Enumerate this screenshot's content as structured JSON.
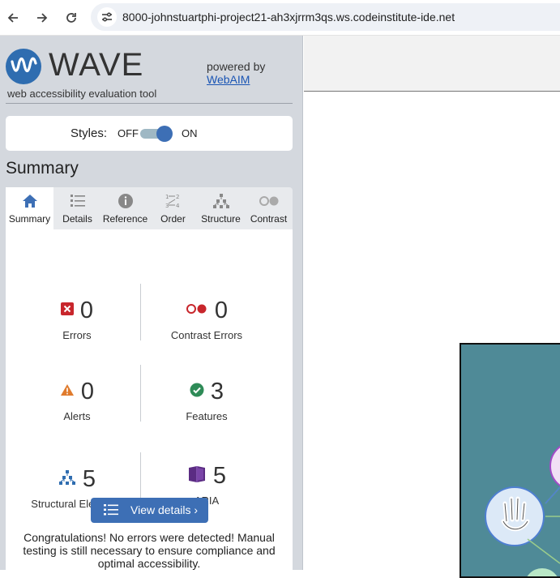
{
  "browser": {
    "url": "8000-johnstuartphi-project21-ah3xjrrm3qs.ws.codeinstitute-ide.net",
    "icons": [
      "back-arrow-icon",
      "forward-arrow-icon",
      "reload-icon",
      "site-info-icon"
    ]
  },
  "wave": {
    "logo_text": "WAVE",
    "tagline": "web accessibility evaluation tool",
    "powered_by": "powered by",
    "webaim_link": "WebAIM",
    "styles_label": "Styles:",
    "styles_off": "OFF",
    "styles_on": "ON",
    "styles_enabled": true,
    "summary_heading": "Summary",
    "tabs": [
      {
        "label": "Summary",
        "icon": "home-icon",
        "active": true
      },
      {
        "label": "Details",
        "icon": "list-icon",
        "active": false
      },
      {
        "label": "Reference",
        "icon": "info-icon",
        "active": false
      },
      {
        "label": "Order",
        "icon": "order-icon",
        "active": false
      },
      {
        "label": "Structure",
        "icon": "structure-icon",
        "active": false
      },
      {
        "label": "Contrast",
        "icon": "contrast-icon",
        "active": false
      }
    ],
    "stats": {
      "errors": {
        "count": "0",
        "label": "Errors",
        "icon": "error-x-icon",
        "color": "#c8262c"
      },
      "contrast": {
        "count": "0",
        "label": "Contrast Errors",
        "icon": "contrast-circles-icon",
        "color": "#c8262c"
      },
      "alerts": {
        "count": "0",
        "label": "Alerts",
        "icon": "alert-triangle-icon",
        "color": "#e07b2d"
      },
      "features": {
        "count": "3",
        "label": "Features",
        "icon": "check-circle-icon",
        "color": "#2e8b57"
      },
      "structural": {
        "count": "5",
        "label": "Structural Elements",
        "icon": "structure-tree-icon",
        "color": "#2f6db0"
      },
      "aria": {
        "count": "5",
        "label": "ARIA",
        "icon": "aria-cube-icon",
        "color": "#5b2c83"
      }
    },
    "view_details": "View details ›",
    "congrats": "Congratulations! No errors were detected! Manual testing is still necessary to ensure compliance and optimal accessibility."
  },
  "colors": {
    "accent": "#3d6fb5",
    "sidebar_bg": "#d4d8de"
  }
}
